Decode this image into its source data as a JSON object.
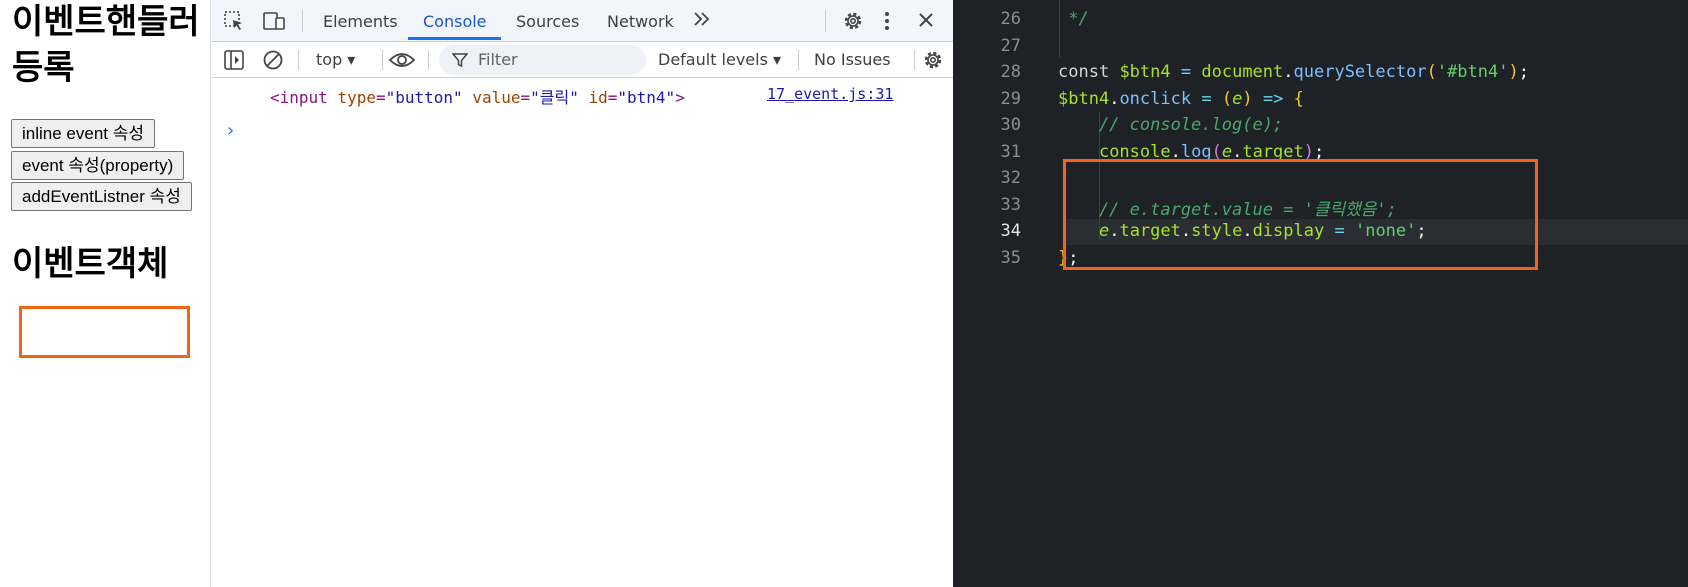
{
  "page": {
    "heading_handler": "이벤트핸들러  등록",
    "buttons": [
      "inline event 속성",
      "event 속성(property)",
      "addEventListner 속성"
    ],
    "heading_object": "이벤트객체"
  },
  "devtools": {
    "tabs": [
      "Elements",
      "Console",
      "Sources",
      "Network"
    ],
    "active_tab": "Console",
    "toolbar": {
      "context": "top",
      "filter_placeholder": "Filter",
      "levels": "Default levels",
      "issues": "No Issues"
    },
    "console": {
      "tag_open": "<input",
      "attr_type": "type",
      "val_type": "\"button\"",
      "attr_value": "value",
      "val_value": "\"클릭\"",
      "attr_id": "id",
      "val_id": "\"btn4\"",
      "tag_close": ">",
      "source": "17_event.js:31"
    }
  },
  "editor": {
    "lines": [
      {
        "n": "26",
        "text": " */"
      },
      {
        "n": "27",
        "text": ""
      },
      {
        "n": "28",
        "text": "const $btn4 = document.querySelector('#btn4');"
      },
      {
        "n": "29",
        "text": "$btn4.onclick = (e) => {"
      },
      {
        "n": "30",
        "text": "    // console.log(e);"
      },
      {
        "n": "31",
        "text": "    console.log(e.target);"
      },
      {
        "n": "32",
        "text": ""
      },
      {
        "n": "33",
        "text": "    // e.target.value = '클릭했음';"
      },
      {
        "n": "34",
        "text": "    e.target.style.display = 'none';"
      },
      {
        "n": "35",
        "text": "};"
      }
    ],
    "active_line": "34"
  },
  "colors": {
    "highlight": "#f26418",
    "editor_bg": "#1e2125",
    "console_tab": "#1a73e8"
  }
}
